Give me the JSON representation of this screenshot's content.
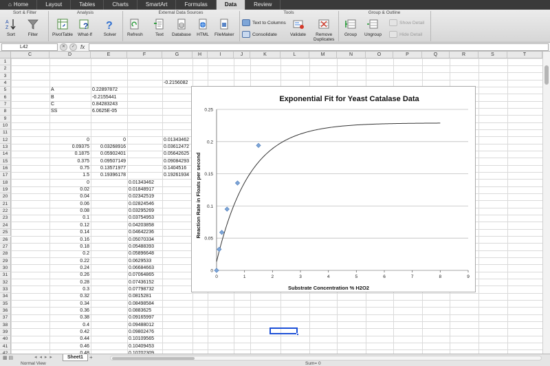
{
  "ribbon": {
    "tabs": [
      "Home",
      "Layout",
      "Tables",
      "Charts",
      "SmartArt",
      "Formulas",
      "Data",
      "Review"
    ],
    "active_tab": "Data",
    "groups": {
      "sort_filter": "Sort & Filter",
      "analysis": "Analysis",
      "external": "External Data Sources",
      "tools": "Tools",
      "group_outline": "Group & Outline"
    },
    "buttons": {
      "sort": "Sort",
      "filter": "Filter",
      "pivottable": "PivotTable",
      "whatif": "What-If",
      "solver": "Solver",
      "refresh": "Refresh",
      "text": "Text",
      "database": "Database",
      "html": "HTML",
      "filemaker": "FileMaker",
      "text_to_columns": "Text to Columns",
      "consolidate": "Consolidate",
      "validate": "Validate",
      "remove_duplicates_1": "Remove",
      "remove_duplicates_2": "Duplicates",
      "group": "Group",
      "ungroup": "Ungroup",
      "show_detail": "Show Detail",
      "hide_detail": "Hide Detail"
    }
  },
  "formula_bar": {
    "name_box": "L42",
    "fx": "fx",
    "cancel": "✕",
    "confirm": "✓"
  },
  "columns": [
    "C",
    "D",
    "E",
    "F",
    "G",
    "H",
    "I",
    "J",
    "K",
    "L",
    "M",
    "N",
    "O",
    "P",
    "Q",
    "R",
    "S",
    "T"
  ],
  "rows": [
    "1",
    "2",
    "3",
    "4",
    "5",
    "6",
    "7",
    "8",
    "9",
    "10",
    "11",
    "12",
    "13",
    "14",
    "15",
    "16",
    "17",
    "18",
    "19",
    "20",
    "21",
    "22",
    "23",
    "24",
    "25",
    "26",
    "27",
    "28",
    "29",
    "30",
    "31",
    "32",
    "33",
    "34",
    "35",
    "36",
    "37",
    "38",
    "39",
    "40",
    "41",
    "42",
    "43",
    "44"
  ],
  "cells": {
    "g4": "-0.2156082",
    "params": [
      {
        "label": "A",
        "value": "0.22897872"
      },
      {
        "label": "B",
        "value": "-0.2155441"
      },
      {
        "label": "C",
        "value": "0.84283243"
      },
      {
        "label": "SS",
        "value": "6.0625E-05"
      }
    ],
    "data_rows": [
      {
        "d": "0",
        "e": "0",
        "g": "0.01343462",
        "h": "0.01343462"
      },
      {
        "d": "0.09375",
        "e": "0.03268916",
        "g": "0.03612472",
        "h": "1.1803E-05"
      },
      {
        "d": "0.1875",
        "e": "0.05902401",
        "g": "0.05642625",
        "h": "6.7484E-06"
      },
      {
        "d": "0.375",
        "e": "0.09507149",
        "g": "0.09084293",
        "h": "1.7881E-05"
      },
      {
        "d": "0.75",
        "e": "0.13571977",
        "g": "0.1404516",
        "h": "2.239E-05"
      },
      {
        "d": "1.5",
        "e": "0.19396178",
        "g": "0.19261934",
        "h": "1.8022E-06"
      }
    ],
    "fit_rows": [
      {
        "d": "0",
        "f": "0.01343462"
      },
      {
        "d": "0.02",
        "f": "0.01848917"
      },
      {
        "d": "0.04",
        "f": "0.02342519"
      },
      {
        "d": "0.06",
        "f": "0.02824546"
      },
      {
        "d": "0.08",
        "f": "0.03295269"
      },
      {
        "d": "0.1",
        "f": "0.03754953"
      },
      {
        "d": "0.12",
        "f": "0.04203858"
      },
      {
        "d": "0.14",
        "f": "0.04642236"
      },
      {
        "d": "0.16",
        "f": "0.05070334"
      },
      {
        "d": "0.18",
        "f": "0.05488393"
      },
      {
        "d": "0.2",
        "f": "0.05896648"
      },
      {
        "d": "0.22",
        "f": "0.0629533"
      },
      {
        "d": "0.24",
        "f": "0.06684663"
      },
      {
        "d": "0.26",
        "f": "0.07064865"
      },
      {
        "d": "0.28",
        "f": "0.07436152"
      },
      {
        "d": "0.3",
        "f": "0.07798732"
      },
      {
        "d": "0.32",
        "f": "0.0815281"
      },
      {
        "d": "0.34",
        "f": "0.08498584"
      },
      {
        "d": "0.36",
        "f": "0.0883625"
      },
      {
        "d": "0.38",
        "f": "0.09165997"
      },
      {
        "d": "0.4",
        "f": "0.09488012"
      },
      {
        "d": "0.42",
        "f": "0.09802476"
      },
      {
        "d": "0.44",
        "f": "0.10109565"
      },
      {
        "d": "0.46",
        "f": "0.10409453"
      },
      {
        "d": "0.48",
        "f": "0.10702309"
      },
      {
        "d": "0.5",
        "f": "0.10988297"
      },
      {
        "d": "0.52",
        "f": "0.11267579"
      },
      {
        "d": "0.54",
        "f": "0.11540311"
      }
    ]
  },
  "chart_data": {
    "type": "scatter",
    "title": "Exponential Fit for Yeast Catalase Data",
    "xlabel": "Substrate Concentration % H2O2",
    "ylabel": "Reaction Rate in Floats per second",
    "xlim": [
      0,
      9
    ],
    "ylim": [
      0,
      0.25
    ],
    "x_ticks": [
      "0",
      "1",
      "2",
      "3",
      "4",
      "5",
      "6",
      "7",
      "8",
      "9"
    ],
    "y_ticks": [
      "0",
      "0.05",
      "0.1",
      "0.15",
      "0.2",
      "0.25"
    ],
    "grid": true,
    "series": [
      {
        "points": [
          [
            0,
            0
          ],
          [
            0.09375,
            0.0327
          ],
          [
            0.1875,
            0.059
          ],
          [
            0.375,
            0.0951
          ],
          [
            0.75,
            0.1357
          ],
          [
            1.5,
            0.194
          ]
        ],
        "style": "markers",
        "color": "#7ea6d8"
      },
      {
        "function": "A + B*exp(-C*x)",
        "params": {
          "A": 0.22897872,
          "B": -0.2155441,
          "C": 0.84283243
        },
        "x_range": [
          0,
          8
        ],
        "style": "line",
        "color": "#333333"
      }
    ]
  },
  "bottom": {
    "sheet_tab": "Sheet1",
    "add_sheet": "+",
    "view": "Normal View",
    "sum": "Sum= 0"
  }
}
